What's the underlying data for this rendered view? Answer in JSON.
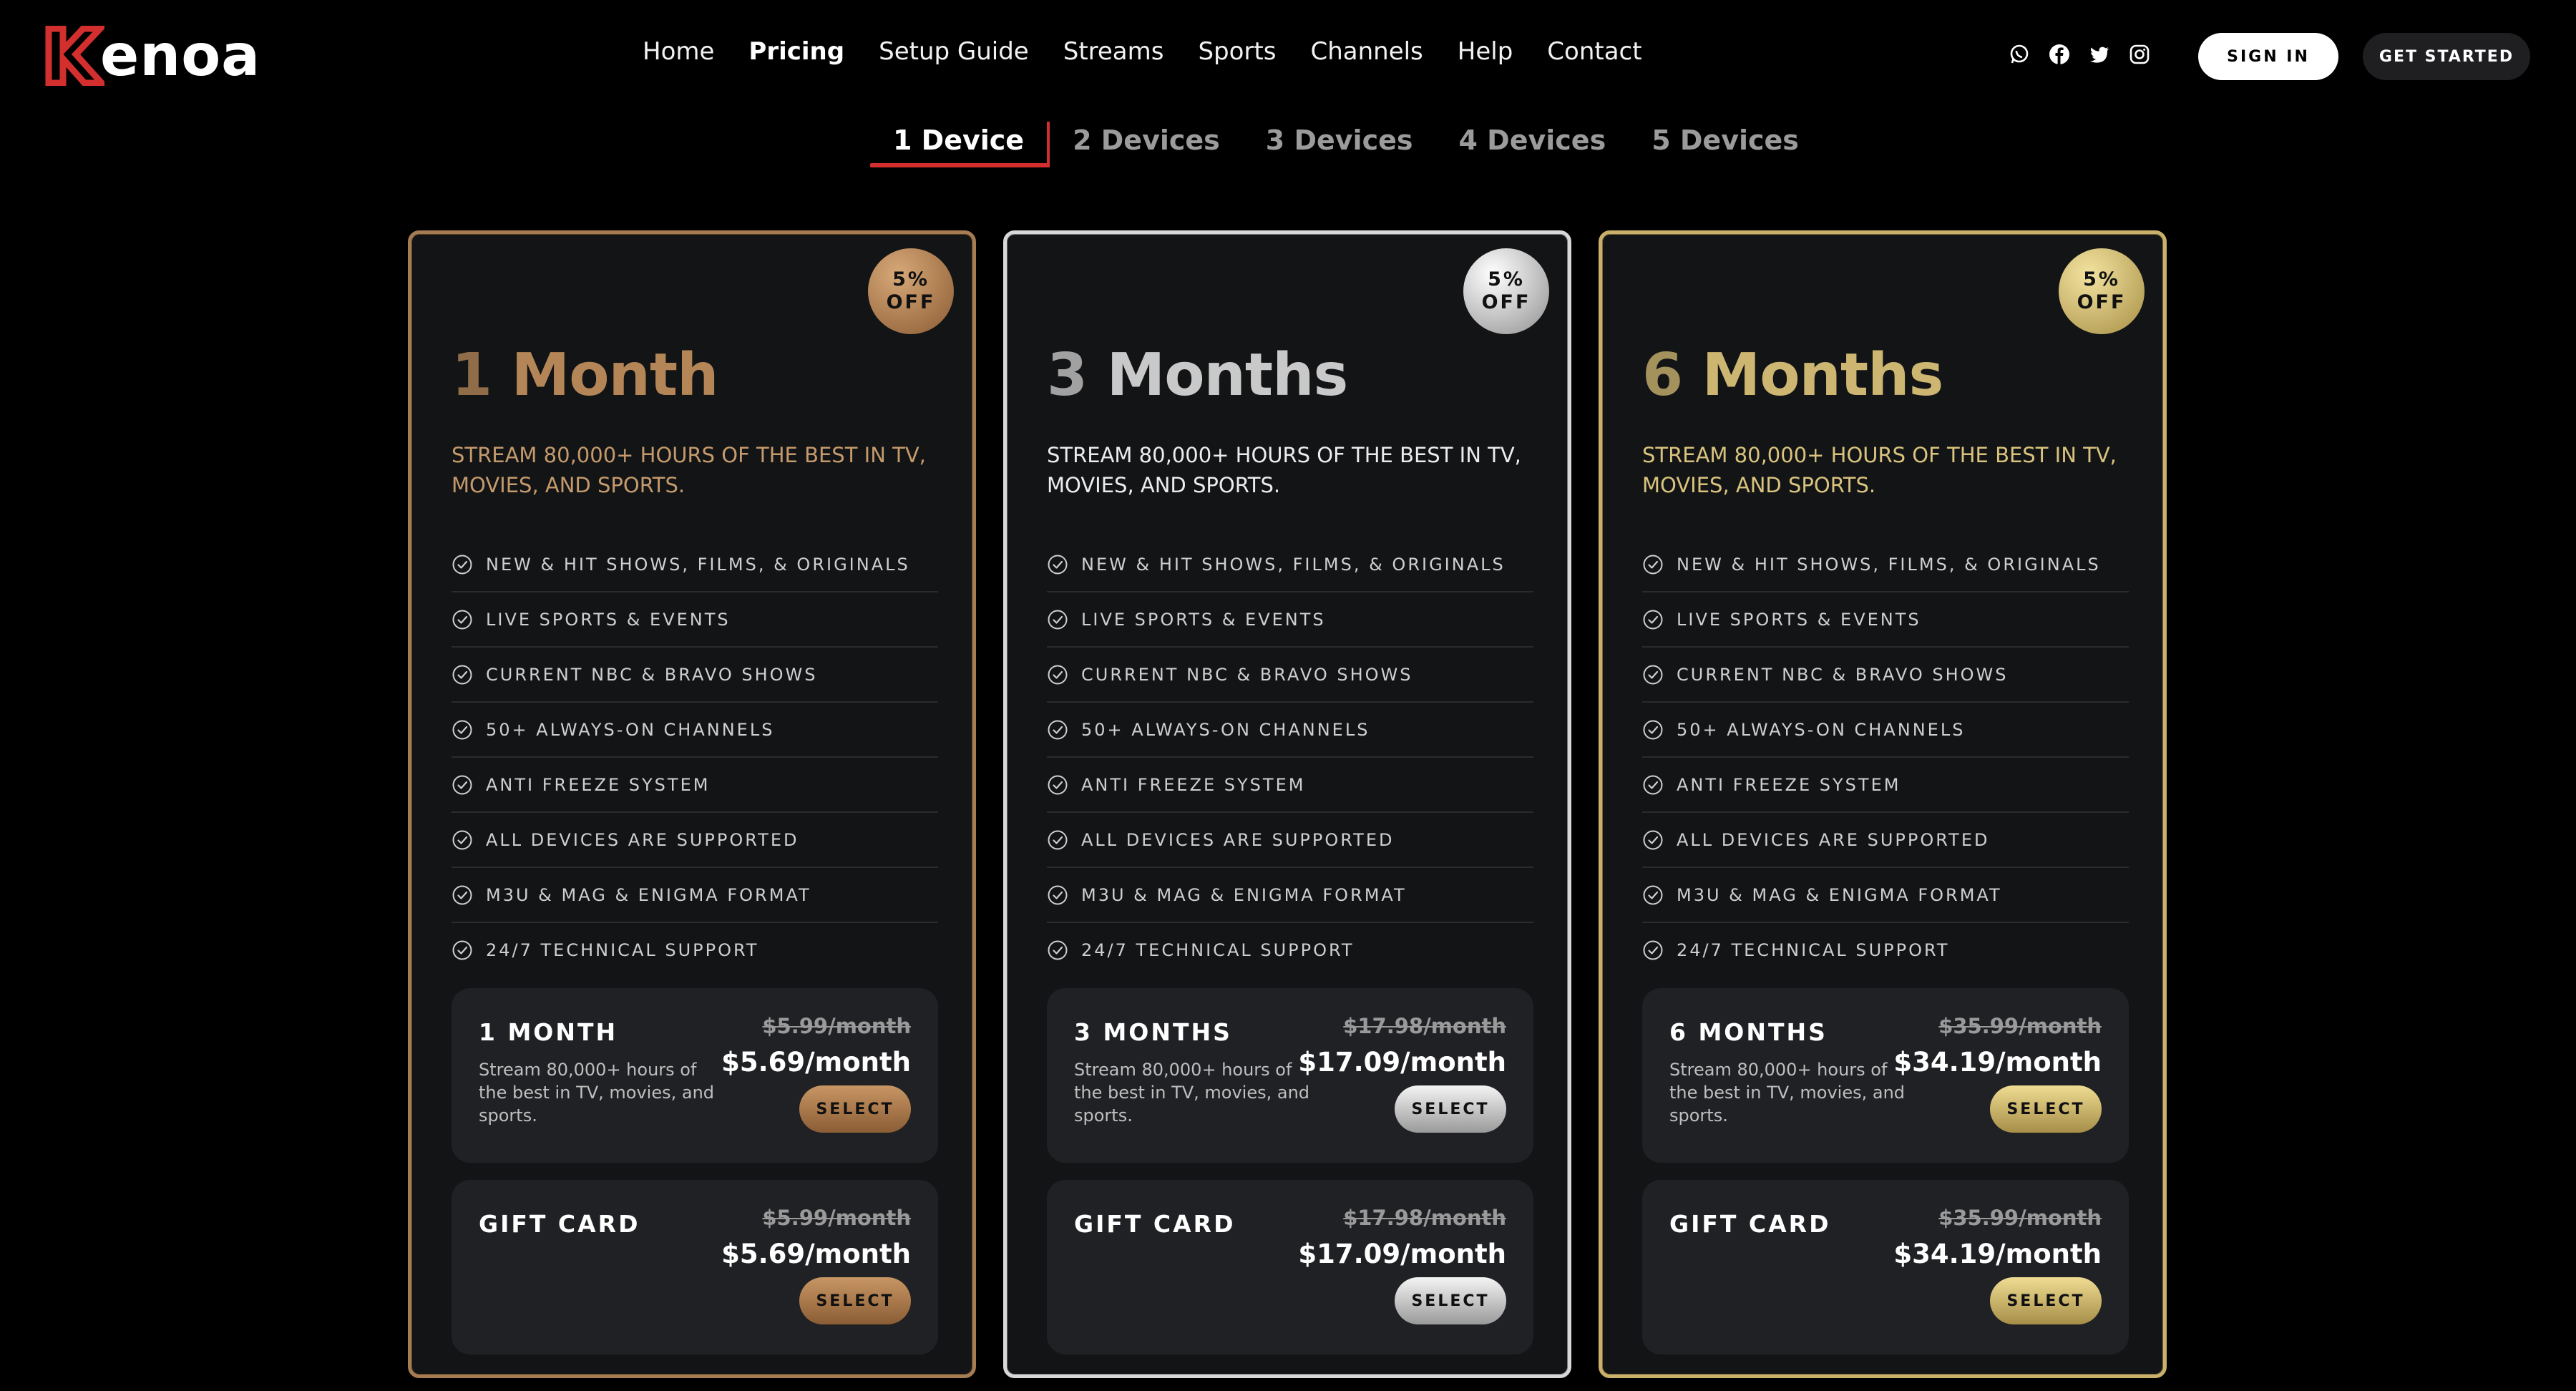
{
  "brand": {
    "name": "enoa",
    "accent": "#d32f2f"
  },
  "nav": {
    "items": [
      {
        "label": "Home",
        "active": false
      },
      {
        "label": "Pricing",
        "active": true
      },
      {
        "label": "Setup Guide",
        "active": false
      },
      {
        "label": "Streams",
        "active": false
      },
      {
        "label": "Sports",
        "active": false
      },
      {
        "label": "Channels",
        "active": false
      },
      {
        "label": "Help",
        "active": false
      },
      {
        "label": "Contact",
        "active": false
      }
    ],
    "social_icons": [
      "whatsapp-icon",
      "facebook-icon",
      "twitter-icon",
      "instagram-icon"
    ],
    "sign_in": "SIGN IN",
    "get_started": "GET STARTED"
  },
  "device_tabs": [
    {
      "label": "1 Device",
      "active": true
    },
    {
      "label": "2 Devices",
      "active": false
    },
    {
      "label": "3 Devices",
      "active": false
    },
    {
      "label": "4 Devices",
      "active": false
    },
    {
      "label": "5 Devices",
      "active": false
    }
  ],
  "plans": [
    {
      "theme": "bronze",
      "badge_line1": "5%",
      "badge_line2": "OFF",
      "title_num": "1",
      "title_word": "Month",
      "description": "STREAM 80,000+ HOURS OF THE BEST IN TV, MOVIES, AND SPORTS.",
      "features": [
        "NEW & HIT SHOWS, FILMS, & ORIGINALS",
        "LIVE SPORTS & EVENTS",
        "CURRENT NBC & BRAVO SHOWS",
        "50+ ALWAYS-ON CHANNELS",
        "ANTI FREEZE SYSTEM",
        "ALL DEVICES ARE SUPPORTED",
        "M3U & MAG & ENIGMA FORMAT",
        "24/7 TECHNICAL SUPPORT"
      ],
      "plan_box": {
        "name": "1 MONTH",
        "desc": "Stream 80,000+ hours of the best in TV, movies, and sports.",
        "old_price": "$5.99/month",
        "new_price": "$5.69/month",
        "select": "SELECT"
      },
      "gift_box": {
        "name": "GIFT CARD",
        "old_price": "$5.99/month",
        "new_price": "$5.69/month",
        "select": "SELECT"
      }
    },
    {
      "theme": "silver",
      "badge_line1": "5%",
      "badge_line2": "OFF",
      "title_num": "3",
      "title_word": "Months",
      "description": "STREAM 80,000+ HOURS OF THE BEST IN TV, MOVIES, AND SPORTS.",
      "features": [
        "NEW & HIT SHOWS, FILMS, & ORIGINALS",
        "LIVE SPORTS & EVENTS",
        "CURRENT NBC & BRAVO SHOWS",
        "50+ ALWAYS-ON CHANNELS",
        "ANTI FREEZE SYSTEM",
        "ALL DEVICES ARE SUPPORTED",
        "M3U & MAG & ENIGMA FORMAT",
        "24/7 TECHNICAL SUPPORT"
      ],
      "plan_box": {
        "name": "3 MONTHS",
        "desc": "Stream 80,000+ hours of the best in TV, movies, and sports.",
        "old_price": "$17.98/month",
        "new_price": "$17.09/month",
        "select": "SELECT"
      },
      "gift_box": {
        "name": "GIFT CARD",
        "old_price": "$17.98/month",
        "new_price": "$17.09/month",
        "select": "SELECT"
      }
    },
    {
      "theme": "gold",
      "badge_line1": "5%",
      "badge_line2": "OFF",
      "title_num": "6",
      "title_word": "Months",
      "description": "STREAM 80,000+ HOURS OF THE BEST IN TV, MOVIES, AND SPORTS.",
      "features": [
        "NEW & HIT SHOWS, FILMS, & ORIGINALS",
        "LIVE SPORTS & EVENTS",
        "CURRENT NBC & BRAVO SHOWS",
        "50+ ALWAYS-ON CHANNELS",
        "ANTI FREEZE SYSTEM",
        "ALL DEVICES ARE SUPPORTED",
        "M3U & MAG & ENIGMA FORMAT",
        "24/7 TECHNICAL SUPPORT"
      ],
      "plan_box": {
        "name": "6 MONTHS",
        "desc": "Stream 80,000+ hours of the best in TV, movies, and sports.",
        "old_price": "$35.99/month",
        "new_price": "$34.19/month",
        "select": "SELECT"
      },
      "gift_box": {
        "name": "GIFT CARD",
        "old_price": "$35.99/month",
        "new_price": "$34.19/month",
        "select": "SELECT"
      }
    }
  ]
}
